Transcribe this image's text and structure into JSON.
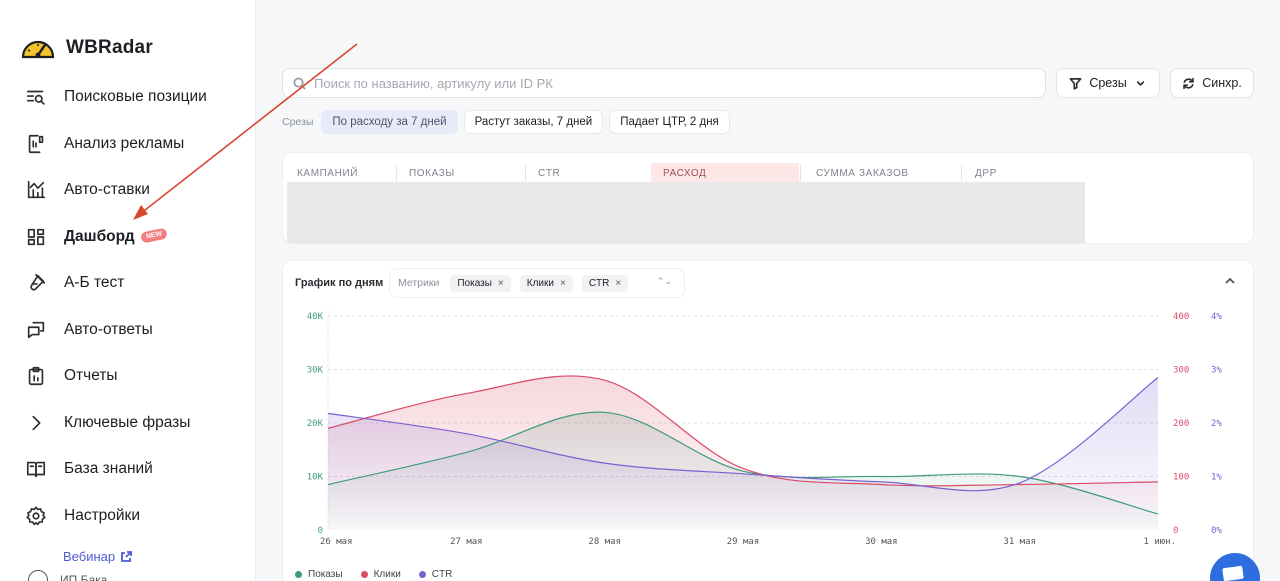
{
  "brand": {
    "name": "WBRadar"
  },
  "sidebar": {
    "items": [
      {
        "label": "Поисковые позиции",
        "icon": "search-list-icon"
      },
      {
        "label": "Анализ рекламы",
        "icon": "clipboard-chart-icon"
      },
      {
        "label": "Авто-ставки",
        "icon": "bar-trend-icon"
      },
      {
        "label": "Дашборд",
        "icon": "dashboard-grid-icon",
        "active": true,
        "badge": "new"
      },
      {
        "label": "А-Б тест",
        "icon": "flask-icon"
      },
      {
        "label": "Авто-ответы",
        "icon": "chat-reply-icon"
      },
      {
        "label": "Отчеты",
        "icon": "report-clipboard-icon"
      },
      {
        "label": "Ключевые фразы",
        "icon": "chevron-right-icon"
      },
      {
        "label": "База знаний",
        "icon": "book-icon"
      },
      {
        "label": "Настройки",
        "icon": "gear-icon"
      }
    ],
    "webinar": "Вебинар",
    "user_label": "ИП Бака"
  },
  "search": {
    "placeholder": "Поиск по названию, артикулу или ID РК"
  },
  "toolbar": {
    "slices_label": "Срезы",
    "sync_label": "Синхр."
  },
  "slices": {
    "label": "Срезы",
    "chips": [
      {
        "label": "По расходу за 7 дней",
        "active": true
      },
      {
        "label": "Растут заказы, 7 дней",
        "active": false
      },
      {
        "label": "Падает ЦТР, 2 дня",
        "active": false
      }
    ]
  },
  "table": {
    "headers": [
      "КАМПАНИЙ",
      "ПОКАЗЫ",
      "CTR",
      "РАСХОД",
      "СУММА ЗАКАЗОВ",
      "ДРР"
    ]
  },
  "chart_panel": {
    "title": "График по дням",
    "metrics_label": "Метрики",
    "metrics": [
      "Показы",
      "Клики",
      "CTR"
    ],
    "legend": [
      "Показы",
      "Клики",
      "CTR"
    ]
  },
  "colors": {
    "shows": "#3e9b7c",
    "clicks": "#d84b67",
    "ctr": "#7a60d0",
    "accent": "#4c5bd4"
  },
  "chart_data": {
    "type": "area",
    "x": [
      "26 мая",
      "27 мая",
      "28 мая",
      "29 мая",
      "30 мая",
      "31 мая",
      "1 июн."
    ],
    "y_left": {
      "ticks": [
        "0",
        "10K",
        "20K",
        "30K",
        "40K"
      ],
      "range": [
        0,
        40000
      ]
    },
    "y_right_clicks": {
      "ticks": [
        "0",
        "100",
        "200",
        "300",
        "400"
      ],
      "range": [
        0,
        400
      ]
    },
    "y_right_ctr": {
      "ticks": [
        "0%",
        "1%",
        "2%",
        "3%",
        "4%"
      ],
      "range": [
        0,
        4
      ]
    },
    "series": [
      {
        "name": "Показы",
        "axis": "left",
        "values": [
          8500,
          14500,
          22000,
          11000,
          10000,
          10000,
          3000
        ]
      },
      {
        "name": "Клики",
        "axis": "clicks",
        "values": [
          190,
          255,
          280,
          115,
          85,
          85,
          90
        ]
      },
      {
        "name": "CTR",
        "axis": "ctr",
        "values": [
          2.18,
          1.8,
          1.25,
          1.05,
          0.9,
          0.88,
          2.85
        ]
      }
    ]
  }
}
